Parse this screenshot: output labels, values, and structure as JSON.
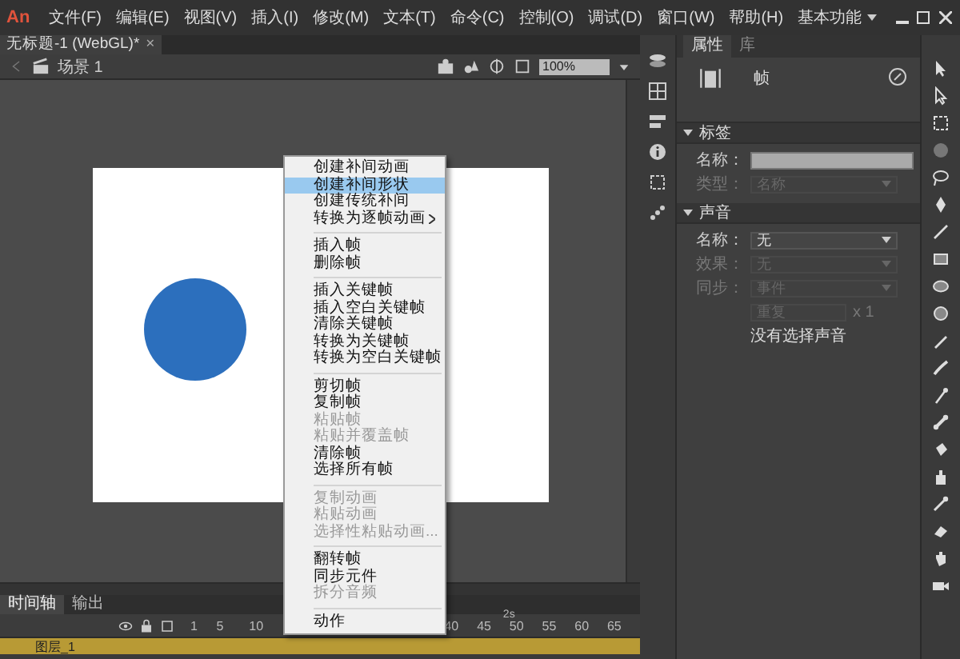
{
  "menu_bar": {
    "logo": "An",
    "menus": [
      "文件(F)",
      "编辑(E)",
      "视图(V)",
      "插入(I)",
      "修改(M)",
      "文本(T)",
      "命令(C)",
      "控制(O)",
      "调试(D)",
      "窗口(W)",
      "帮助(H)"
    ],
    "workspace": "基本功能"
  },
  "document_tab": {
    "title": "无标题-1 (WebGL)*",
    "close": "×"
  },
  "edit_bar": {
    "scene": "场景 1",
    "zoom": "100%"
  },
  "context_menu": {
    "groups": [
      [
        {
          "label": "创建补间动画",
          "selected": false,
          "disabled": false,
          "submenu": false
        },
        {
          "label": "创建补间形状",
          "selected": true,
          "disabled": false,
          "submenu": false
        },
        {
          "label": "创建传统补间",
          "selected": false,
          "disabled": false,
          "submenu": false
        },
        {
          "label": "转换为逐帧动画",
          "selected": false,
          "disabled": false,
          "submenu": true
        }
      ],
      [
        {
          "label": "插入帧",
          "selected": false,
          "disabled": false,
          "submenu": false
        },
        {
          "label": "删除帧",
          "selected": false,
          "disabled": false,
          "submenu": false
        }
      ],
      [
        {
          "label": "插入关键帧",
          "selected": false,
          "disabled": false,
          "submenu": false
        },
        {
          "label": "插入空白关键帧",
          "selected": false,
          "disabled": false,
          "submenu": false
        },
        {
          "label": "清除关键帧",
          "selected": false,
          "disabled": false,
          "submenu": false
        },
        {
          "label": "转换为关键帧",
          "selected": false,
          "disabled": false,
          "submenu": false
        },
        {
          "label": "转换为空白关键帧",
          "selected": false,
          "disabled": false,
          "submenu": false
        }
      ],
      [
        {
          "label": "剪切帧",
          "selected": false,
          "disabled": false,
          "submenu": false
        },
        {
          "label": "复制帧",
          "selected": false,
          "disabled": false,
          "submenu": false
        },
        {
          "label": "粘贴帧",
          "selected": false,
          "disabled": true,
          "submenu": false
        },
        {
          "label": "粘贴并覆盖帧",
          "selected": false,
          "disabled": true,
          "submenu": false
        },
        {
          "label": "清除帧",
          "selected": false,
          "disabled": false,
          "submenu": false
        },
        {
          "label": "选择所有帧",
          "selected": false,
          "disabled": false,
          "submenu": false
        }
      ],
      [
        {
          "label": "复制动画",
          "selected": false,
          "disabled": true,
          "submenu": false
        },
        {
          "label": "粘贴动画",
          "selected": false,
          "disabled": true,
          "submenu": false
        },
        {
          "label": "选择性粘贴动画...",
          "selected": false,
          "disabled": true,
          "submenu": false
        }
      ],
      [
        {
          "label": "翻转帧",
          "selected": false,
          "disabled": false,
          "submenu": false
        },
        {
          "label": "同步元件",
          "selected": false,
          "disabled": false,
          "submenu": false
        },
        {
          "label": "拆分音频",
          "selected": false,
          "disabled": true,
          "submenu": false
        }
      ],
      [
        {
          "label": "动作",
          "selected": false,
          "disabled": false,
          "submenu": false
        }
      ]
    ]
  },
  "properties": {
    "tabs": [
      {
        "label": "属性",
        "selected": true
      },
      {
        "label": "库",
        "selected": false
      }
    ],
    "object": "帧",
    "sections": [
      {
        "title": "标签",
        "expanded": true,
        "rows": [
          {
            "kind": "input",
            "label": "名称："
          },
          {
            "kind": "select",
            "label": "类型：",
            "value": "名称",
            "disabled": true
          }
        ]
      },
      {
        "title": "声音",
        "expanded": true,
        "rows": [
          {
            "kind": "select",
            "label": "名称：",
            "value": "无",
            "disabled": false
          },
          {
            "kind": "select",
            "label": "效果：",
            "value": "无",
            "disabled": true
          },
          {
            "kind": "select",
            "label": "同步：",
            "value": "事件",
            "disabled": true
          },
          {
            "kind": "repeat",
            "value": "重复",
            "times": "x 1",
            "disabled": true
          },
          {
            "kind": "note",
            "text": "没有选择声音"
          }
        ]
      }
    ]
  },
  "timeline": {
    "tabs": [
      {
        "label": "时间轴",
        "selected": true
      },
      {
        "label": "输出",
        "selected": false
      }
    ],
    "frame_labels": [
      "1",
      "5",
      "10",
      "40",
      "45",
      "50",
      "55",
      "60",
      "65"
    ],
    "time_marker": "2s",
    "layers": [
      {
        "name": "图层_1",
        "selected": true
      }
    ]
  }
}
